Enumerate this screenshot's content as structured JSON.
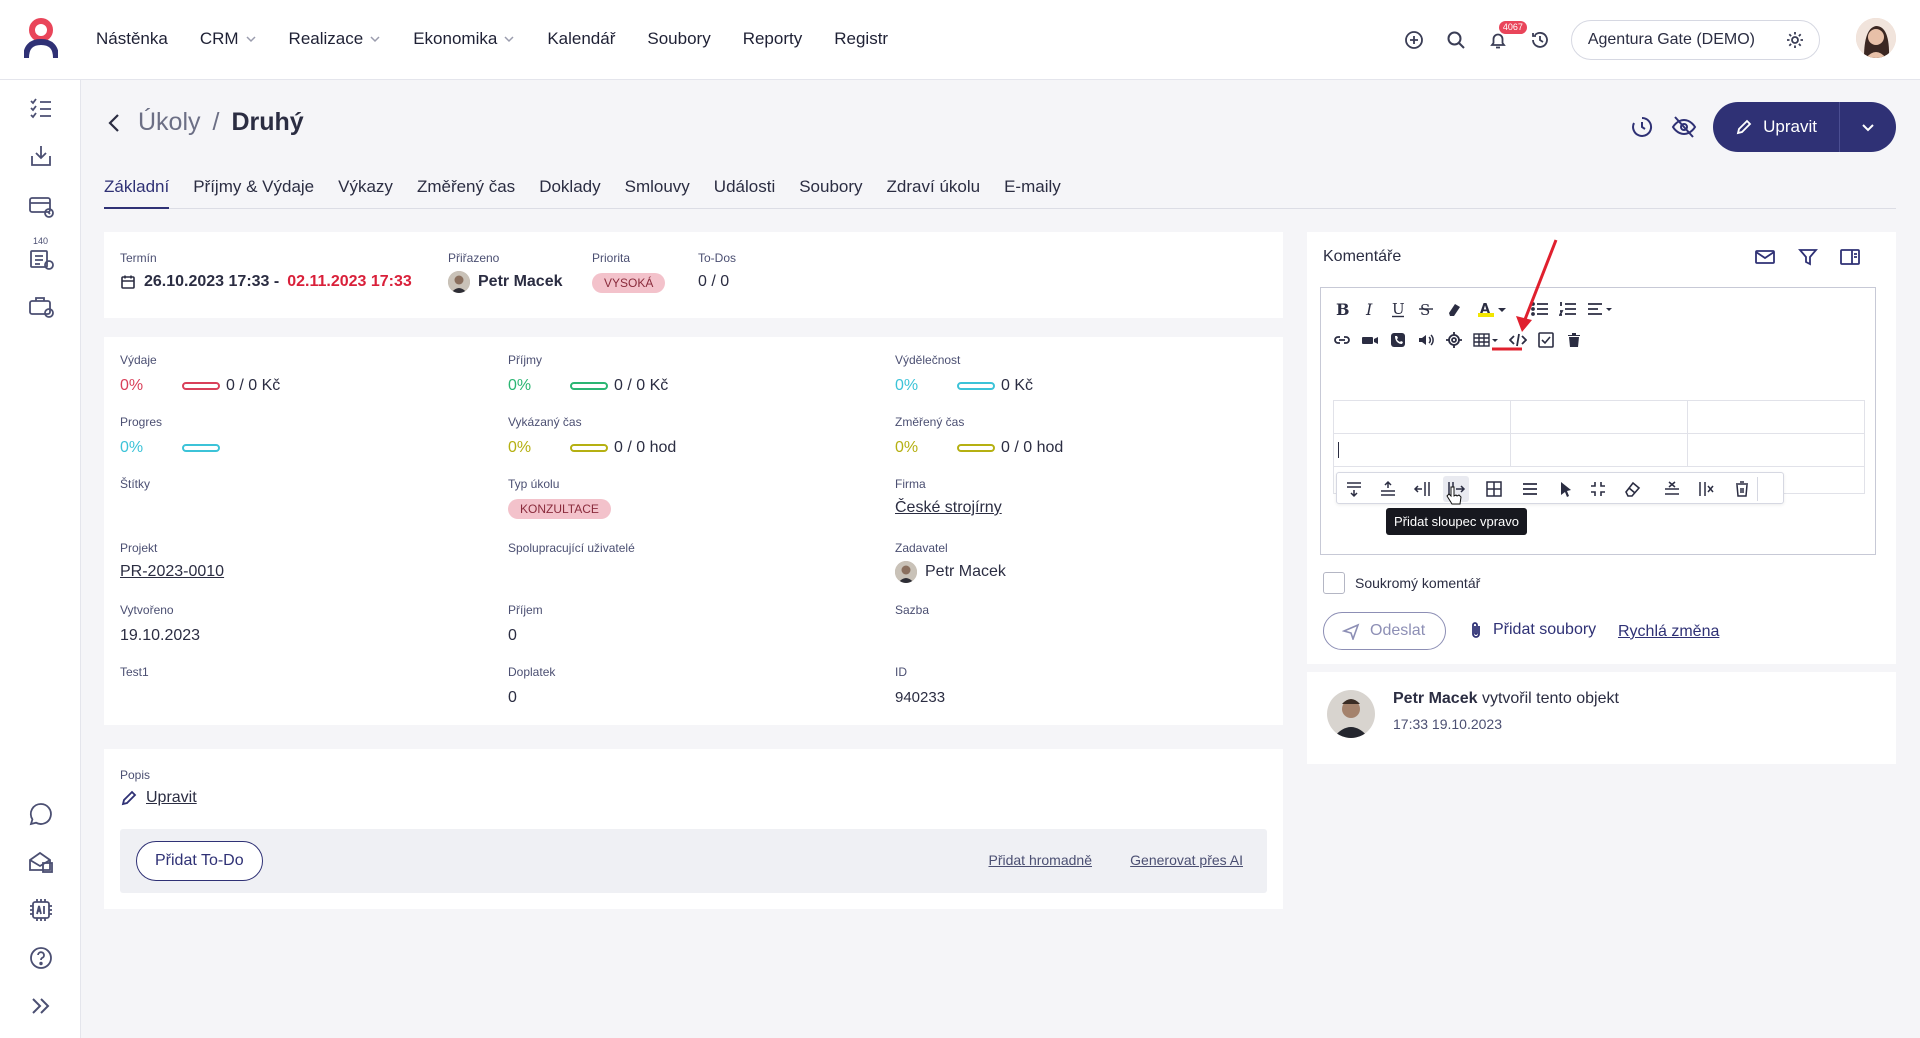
{
  "topbar": {
    "nav": [
      "Nástěnka",
      "CRM",
      "Realizace",
      "Ekonomika",
      "Kalendář",
      "Soubory",
      "Reporty",
      "Registr"
    ],
    "nav_dropdown": [
      false,
      true,
      true,
      true,
      false,
      false,
      false,
      false
    ],
    "notification_count": "4067",
    "company": "Agentura Gate (DEMO)"
  },
  "sidebar": {
    "icons": [
      "tasks-icon",
      "inbox-download-icon",
      "invoice-icon",
      "project-checklist-icon",
      "briefcase-clock-icon"
    ],
    "task_count": "140",
    "bottom_icons": [
      "chat-icon",
      "mail-building-icon",
      "ai-chip-icon",
      "help-icon",
      "expand-icon"
    ]
  },
  "breadcrumb": {
    "parent": "Úkoly",
    "separator": "/",
    "current": "Druhý"
  },
  "header": {
    "edit_label": "Upravit"
  },
  "tabs": [
    "Základní",
    "Příjmy & Výdaje",
    "Výkazy",
    "Změřený čas",
    "Doklady",
    "Smlouvy",
    "Události",
    "Soubory",
    "Zdraví úkolu",
    "E-maily"
  ],
  "summary": {
    "term_label": "Termín",
    "term_start": "26.10.2023 17:33 -",
    "term_end": "02.11.2023 17:33",
    "assigned_label": "Přiřazeno",
    "assigned": "Petr Macek",
    "priority_label": "Priorita",
    "priority": "VYSOKÁ",
    "todos_label": "To-Dos",
    "todos": "0 / 0"
  },
  "details": {
    "expenses": {
      "label": "Výdaje",
      "pct": "0%",
      "value": "0 / 0 Kč",
      "color": "#d9405a",
      "progress": 0
    },
    "income": {
      "label": "Příjmy",
      "pct": "0%",
      "value": "0 / 0 Kč",
      "color": "#2bb673",
      "progress": 0
    },
    "profit": {
      "label": "Výdělečnost",
      "pct": "0%",
      "value": "0 Kč",
      "color": "#3cc3d8",
      "progress": 0
    },
    "progress": {
      "label": "Progres",
      "pct": "0%",
      "color": "#3cc3d8",
      "progress": 0
    },
    "reported": {
      "label": "Vykázaný čas",
      "pct": "0%",
      "value": "0 / 0 hod",
      "color": "#b5b012",
      "progress": 0
    },
    "measured": {
      "label": "Změřený čas",
      "pct": "0%",
      "value": "0 / 0 hod",
      "color": "#b5b012",
      "progress": 0
    },
    "tags_label": "Štítky",
    "task_type_label": "Typ úkolu",
    "task_type": "KONZULTACE",
    "company_label": "Firma",
    "company": "České strojírny",
    "project_label": "Projekt",
    "project": "PR-2023-0010",
    "collaborators_label": "Spolupracující uživatelé",
    "requester_label": "Zadavatel",
    "requester": "Petr Macek",
    "created_label": "Vytvořeno",
    "created": "19.10.2023",
    "income_label": "Příjem",
    "income_value": "0",
    "rate_label": "Sazba",
    "test_label": "Test1",
    "surcharge_label": "Doplatek",
    "surcharge": "0",
    "id_label": "ID",
    "id": "940233"
  },
  "description": {
    "label": "Popis",
    "edit": "Upravit",
    "add_todo": "Přidat To-Do",
    "add_bulk": "Přidat hromadně",
    "generate_ai": "Generovat přes AI"
  },
  "comments": {
    "title": "Komentáře",
    "private_label": "Soukromý komentář",
    "send": "Odeslat",
    "add_files": "Přidat soubory",
    "quick_change": "Rychlá změna",
    "tooltip": "Přidat sloupec vpravo",
    "history": [
      {
        "author": "Petr Macek",
        "action": "vytvořil tento objekt",
        "time": "17:33 19.10.2023"
      }
    ]
  },
  "colors": {
    "primary": "#2f3175",
    "danger": "#d9405a",
    "annotation": "#e0202e"
  }
}
